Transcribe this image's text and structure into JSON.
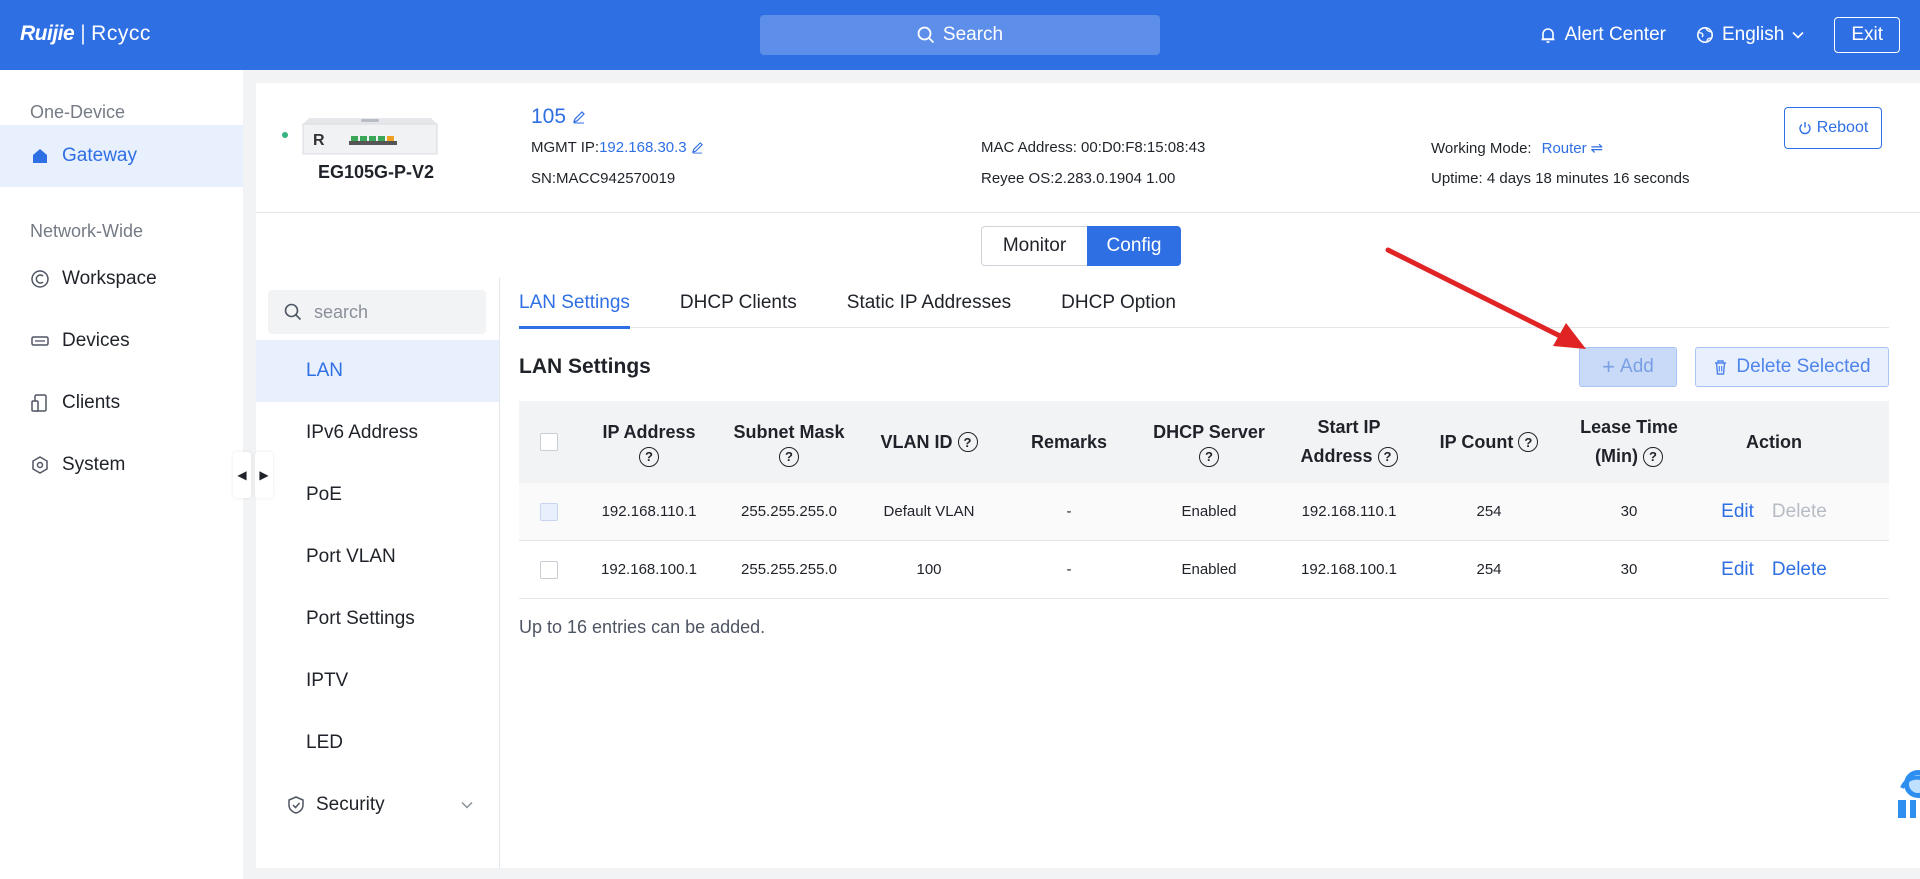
{
  "topbar": {
    "brand": "Ruijie",
    "brand_secondary": "Rcycc",
    "search_label": "Search",
    "alert_center": "Alert Center",
    "language": "English",
    "exit": "Exit"
  },
  "leftnav": {
    "section_one_device": "One-Device",
    "gateway": "Gateway",
    "section_network_wide": "Network-Wide",
    "workspace": "Workspace",
    "devices": "Devices",
    "clients": "Clients",
    "system": "System"
  },
  "device": {
    "model": "EG105G-P-V2",
    "image_badge": "R",
    "name": "105",
    "mgmt_ip_label": "MGMT IP:",
    "mgmt_ip": "192.168.30.3",
    "sn": "SN:MACC942570019",
    "mac": "MAC Address: 00:D0:F8:15:08:43",
    "os": "Reyee OS:2.283.0.1904 1.00",
    "working_mode_label": "Working Mode:",
    "working_mode": "Router",
    "uptime": "Uptime: 4 days 18 minutes 16 seconds",
    "reboot": "Reboot"
  },
  "mode_switch": {
    "monitor": "Monitor",
    "config": "Config",
    "active": "Config"
  },
  "submenu": {
    "search_placeholder": "search",
    "items": [
      "LAN",
      "IPv6 Address",
      "PoE",
      "Port VLAN",
      "Port Settings",
      "IPTV",
      "LED"
    ],
    "group": "Security",
    "active": "LAN"
  },
  "tabs": [
    "LAN Settings",
    "DHCP Clients",
    "Static IP Addresses",
    "DHCP Option"
  ],
  "section": {
    "title": "LAN Settings",
    "add": "Add",
    "delete_selected": "Delete Selected",
    "footnote": "Up to 16 entries can be added."
  },
  "table": {
    "headers": {
      "ip": "IP Address",
      "mask": "Subnet Mask",
      "vlan": "VLAN ID",
      "remarks": "Remarks",
      "dhcp": "DHCP Server",
      "start_l1": "Start IP",
      "start_l2": "Address",
      "count": "IP Count",
      "lease_l1": "Lease Time",
      "lease_l2": "(Min)",
      "action": "Action"
    },
    "rows": [
      {
        "ip": "192.168.110.1",
        "mask": "255.255.255.0",
        "vlan": "Default VLAN",
        "remarks": "-",
        "dhcp": "Enabled",
        "start": "192.168.110.1",
        "count": "254",
        "lease": "30",
        "edit": "Edit",
        "delete": "Delete"
      },
      {
        "ip": "192.168.100.1",
        "mask": "255.255.255.0",
        "vlan": "100",
        "remarks": "-",
        "dhcp": "Enabled",
        "start": "192.168.100.1",
        "count": "254",
        "lease": "30",
        "edit": "Edit",
        "delete": "Delete"
      }
    ]
  },
  "colors": {
    "primary": "#2f6fe4",
    "annotation_arrow": "#e02424",
    "online": "#36b37e"
  }
}
